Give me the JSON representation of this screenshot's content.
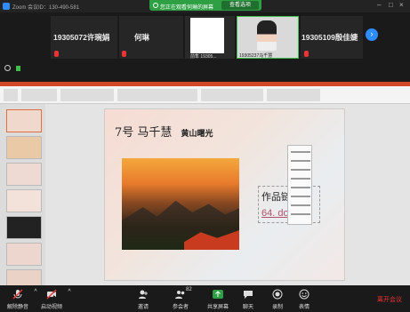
{
  "window": {
    "title": "Zoom 会议ID：130-490-581"
  },
  "share_banner": {
    "text": "您正在观看何琳的屏幕",
    "view_options": "查看选项"
  },
  "participants": [
    {
      "name": "19305072许琬娟"
    },
    {
      "name": "何琳"
    },
    {
      "name": "前隼 19305..."
    },
    {
      "name": "19305237马千慧"
    },
    {
      "name": "19305109殷佳婕"
    }
  ],
  "slide": {
    "title": "7号 马千慧",
    "subtitle": "黄山曙光",
    "works_label": "作品链",
    "works_link": "64. doc"
  },
  "toolbar": {
    "unmute": "解除静音",
    "start_video": "启动视频",
    "invite": "邀请",
    "participants": "参会者",
    "participants_count": "82",
    "share_screen": "共享屏幕",
    "chat": "聊天",
    "record": "录制",
    "reactions": "表情",
    "leave": "离开会议"
  },
  "colors": {
    "share_green": "#2ea043",
    "accent_blue": "#2d8cff",
    "leave_red": "#e33333",
    "ppt_red": "#d24726"
  }
}
